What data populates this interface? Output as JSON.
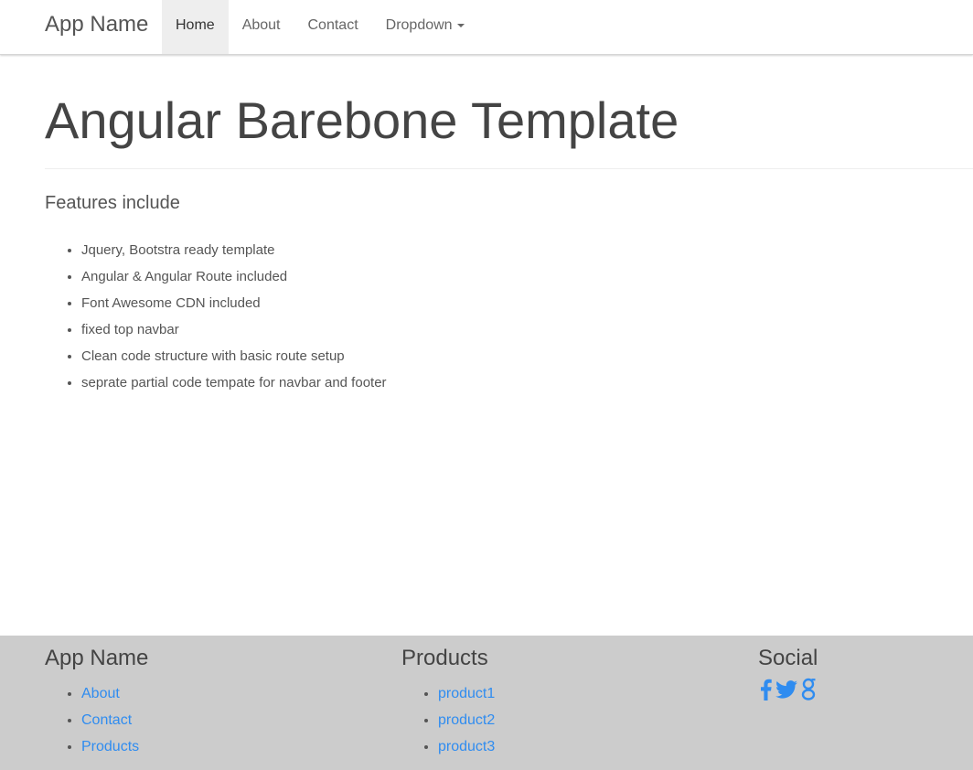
{
  "navbar": {
    "brand": "App Name",
    "items": [
      {
        "label": "Home",
        "active": true
      },
      {
        "label": "About",
        "active": false
      },
      {
        "label": "Contact",
        "active": false
      },
      {
        "label": "Dropdown",
        "active": false
      }
    ]
  },
  "main": {
    "title": "Angular Barebone Template",
    "features_heading": "Features include",
    "features": [
      "Jquery, Bootstra ready template",
      "Angular & Angular Route included",
      "Font Awesome CDN included",
      "fixed top navbar",
      "Clean code structure with basic route setup",
      "seprate partial code tempate for navbar and footer"
    ]
  },
  "footer": {
    "col1": {
      "heading": "App Name",
      "links": [
        "About",
        "Contact",
        "Products"
      ]
    },
    "col2": {
      "heading": "Products",
      "links": [
        "product1",
        "product2",
        "product3"
      ]
    },
    "col3": {
      "heading": "Social",
      "icons": [
        "facebook-icon",
        "twitter-icon",
        "google-plus-icon"
      ]
    }
  },
  "colors": {
    "link": "#2f8cf0",
    "footer_bg": "#cccccc",
    "active_nav_bg": "#eeeeee",
    "text": "#444444"
  }
}
